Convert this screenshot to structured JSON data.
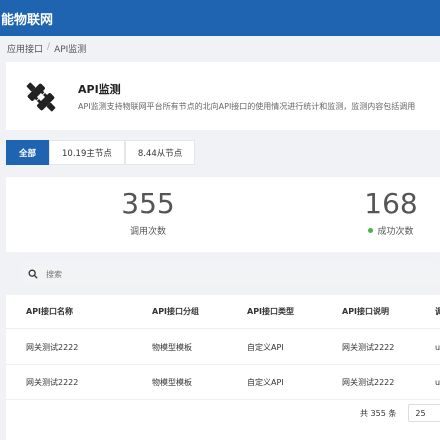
{
  "topbar": {
    "brand": "智能物联网"
  },
  "breadcrumb": {
    "items": [
      "应用接口",
      "API监测"
    ],
    "separator": "/"
  },
  "header": {
    "icon": "plug-icon",
    "title": "API监测",
    "description": "API监测支持物联网平台所有节点的北向API接口的使用情况进行统计和监测，监测内容包括调用"
  },
  "tabs": [
    {
      "label": "全部",
      "active": true
    },
    {
      "label": "10.19主节点",
      "active": false
    },
    {
      "label": "8.44从节点",
      "active": false
    }
  ],
  "stats": {
    "calls": {
      "value": "355",
      "label": "调用次数"
    },
    "success": {
      "value": "168",
      "label": "成功次数",
      "dot_color": "#4caf50"
    }
  },
  "search": {
    "icon": "search-icon",
    "placeholder": "搜索"
  },
  "table": {
    "columns": [
      "API接口名称",
      "API接口分组",
      "API接口类型",
      "API接口说明",
      "调"
    ],
    "rows": [
      [
        "网关测试2222",
        "物模型模板",
        "自定义API",
        "网关测试2222",
        "u"
      ],
      [
        "网关测试2222",
        "物模型模板",
        "自定义API",
        "网关测试2222",
        "u"
      ]
    ]
  },
  "pager": {
    "total": "共 355 条",
    "page_size": "25"
  },
  "colors": {
    "primary": "#1f64b0",
    "success": "#4caf50"
  }
}
